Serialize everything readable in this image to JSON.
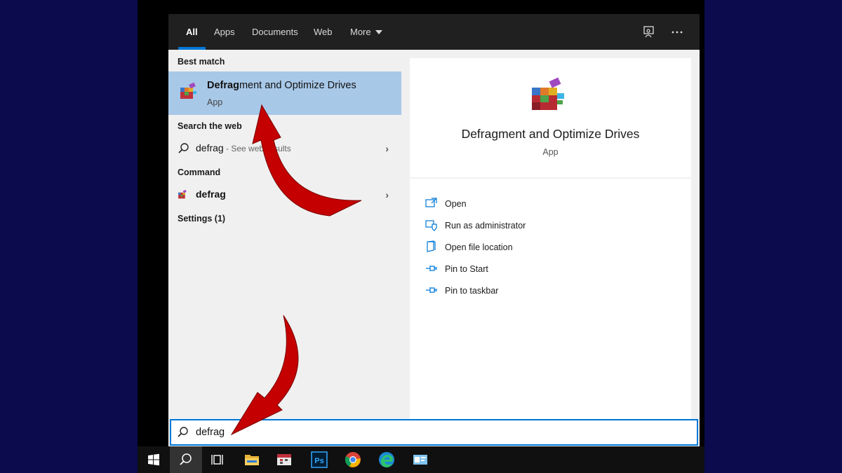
{
  "tabs": [
    {
      "label": "All",
      "active": true
    },
    {
      "label": "Apps"
    },
    {
      "label": "Documents"
    },
    {
      "label": "Web"
    },
    {
      "label": "More"
    }
  ],
  "top_icons": [
    "feedback-icon",
    "more-options-icon"
  ],
  "results": {
    "best_match_header": "Best match",
    "best_match": {
      "title_bold": "Defrag",
      "title_rest": "ment and Optimize Drives",
      "subtitle": "App",
      "icon": "defrag-app-icon"
    },
    "web_header": "Search the web",
    "web_result": {
      "query": "defrag",
      "hint": " - See web results",
      "icon": "search-icon"
    },
    "command_header": "Command",
    "command_result": {
      "label": "defrag",
      "icon": "defrag-app-icon"
    },
    "settings_header": "Settings (1)"
  },
  "preview": {
    "title": "Defragment and Optimize Drives",
    "subtitle": "App",
    "actions": [
      {
        "label": "Open",
        "icon": "open-icon"
      },
      {
        "label": "Run as administrator",
        "icon": "shield-icon"
      },
      {
        "label": "Open file location",
        "icon": "file-location-icon"
      },
      {
        "label": "Pin to Start",
        "icon": "pin-icon"
      },
      {
        "label": "Pin to taskbar",
        "icon": "pin-icon"
      }
    ]
  },
  "search": {
    "value": "defrag",
    "icon": "search-icon"
  },
  "taskbar": {
    "items": [
      "windows-start-icon",
      "search-icon",
      "task-view-icon",
      "file-explorer-icon",
      "calendar-app-icon",
      "photoshop-icon",
      "chrome-icon",
      "edge-icon",
      "control-panel-icon"
    ],
    "photoshop_label": "Ps"
  },
  "colors": {
    "accent": "#0078d7",
    "selection": "#a8c8e8",
    "arrow": "#c40000",
    "background": "#0b0b4e"
  }
}
